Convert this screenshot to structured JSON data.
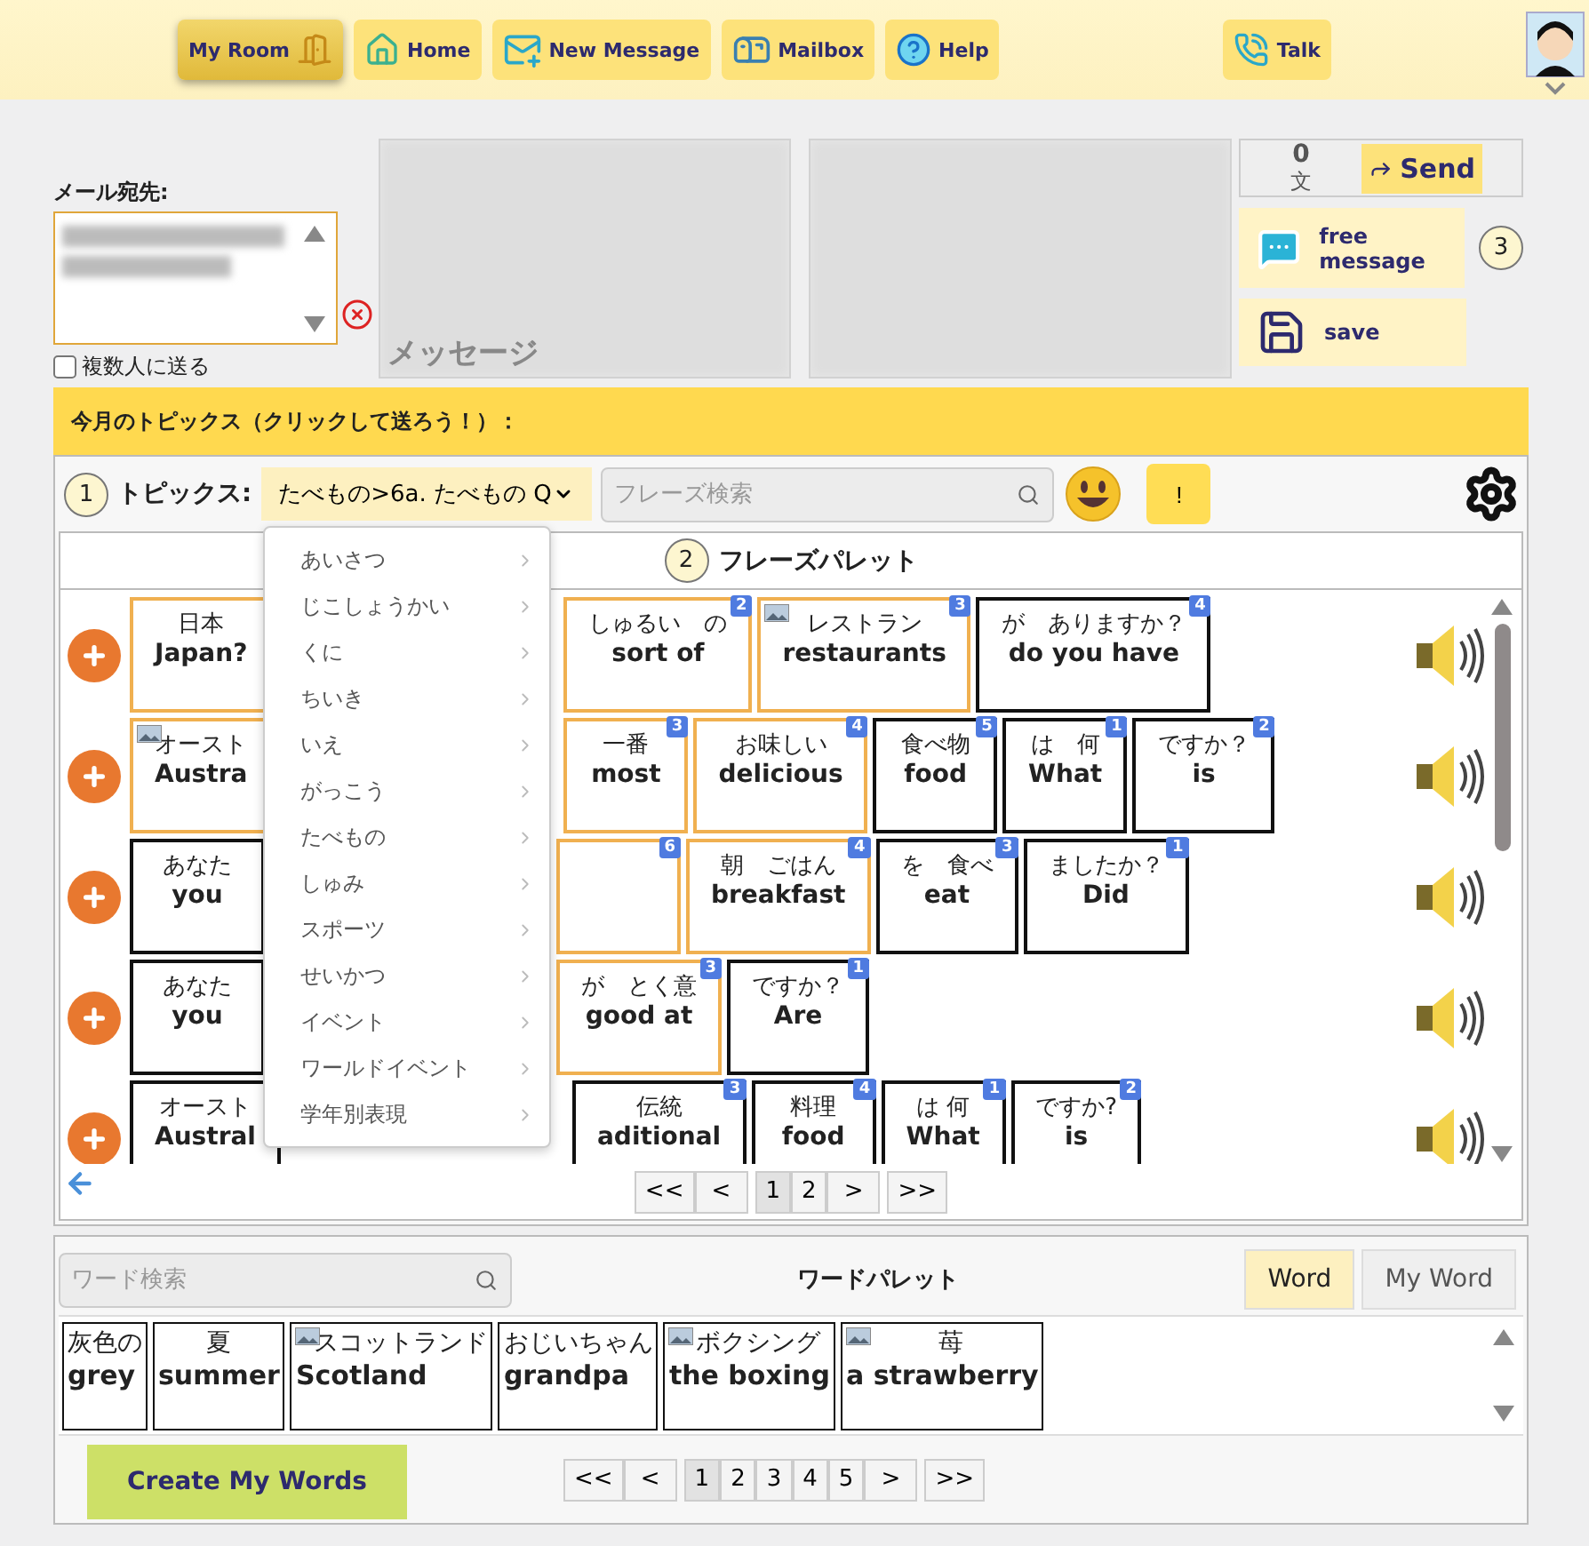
{
  "nav": [
    {
      "label": "My Room",
      "kind": "room",
      "selected": true
    },
    {
      "label": "Home",
      "kind": "home",
      "selected": false
    },
    {
      "label": "New Message",
      "kind": "new",
      "selected": false
    },
    {
      "label": "Mailbox",
      "kind": "mailbox",
      "selected": false
    },
    {
      "label": "Help",
      "kind": "help",
      "selected": false
    },
    {
      "label": "Talk",
      "kind": "talk",
      "selected": false
    }
  ],
  "compose": {
    "recipient_label": "メール宛先:",
    "multi_send": {
      "label": "複数人に送る",
      "checked": false
    },
    "message_placeholder": "メッセージ",
    "count": "0",
    "count_unit": "文",
    "send": "Send",
    "step": "3",
    "free_message": "free message",
    "save": "save"
  },
  "topics_banner": "今月のトピックス（クリックして送ろう！）：",
  "topics": {
    "step": "1",
    "label": "トピックス:",
    "selected": "たべもの>6a. たべもの Q",
    "search_placeholder": "フレーズ検索",
    "alert": "!"
  },
  "menu": [
    "あいさつ",
    "じこしょうかい",
    "くに",
    "ちいき",
    "いえ",
    "がっこう",
    "たべもの",
    "しゅみ",
    "スポーツ",
    "せいかつ",
    "イベント",
    "ワールドイベント",
    "学年別表現"
  ],
  "phrase_palette": {
    "step": "2",
    "title": "フレーズパレット",
    "rows": [
      {
        "first": {
          "jp": "日本",
          "en": "Japan?",
          "highlighted": true,
          "image": false
        },
        "cards": [
          {
            "jp": "しゅるい　の",
            "en": "sort of",
            "badge": "2",
            "highlighted": true,
            "image": false
          },
          {
            "jp": "レストラン",
            "en": "restaurants",
            "badge": "3",
            "highlighted": true,
            "image": true
          },
          {
            "jp": "が　ありますか？",
            "en": "do you have",
            "badge": "4",
            "highlighted": false,
            "image": false
          }
        ]
      },
      {
        "first": {
          "jp": "オースト",
          "en": "Austra",
          "highlighted": true,
          "image": true
        },
        "cards": [
          {
            "jp": "一番",
            "en": "most",
            "badge": "3",
            "highlighted": true,
            "image": false
          },
          {
            "jp": "お味しい",
            "en": "delicious",
            "badge": "4",
            "highlighted": true,
            "image": false
          },
          {
            "jp": "食べ物",
            "en": "food",
            "badge": "5",
            "highlighted": false,
            "image": false
          },
          {
            "jp": "は　何",
            "en": "What",
            "badge": "1",
            "highlighted": false,
            "image": false
          },
          {
            "jp": "ですか？",
            "en": "is",
            "badge": "2",
            "highlighted": false,
            "image": false
          }
        ]
      },
      {
        "first": {
          "jp": "あなた",
          "en": "you",
          "highlighted": false,
          "image": false
        },
        "cards": [
          {
            "badge": "6",
            "highlighted": true,
            "image": false
          },
          {
            "jp": "朝　ごはん",
            "en": "breakfast",
            "badge": "4",
            "highlighted": true,
            "image": false
          },
          {
            "jp": "を　食べ",
            "en": "eat",
            "badge": "3",
            "highlighted": false,
            "image": false
          },
          {
            "jp": "ましたか？",
            "en": "Did",
            "badge": "1",
            "highlighted": false,
            "image": false
          }
        ]
      },
      {
        "first": {
          "jp": "あなた",
          "en": "you",
          "highlighted": false,
          "image": false
        },
        "cards": [
          {
            "jp": "が　とく意",
            "en": "good at",
            "badge": "3",
            "highlighted": true,
            "image": false
          },
          {
            "jp": "ですか？",
            "en": "Are",
            "badge": "1",
            "highlighted": false,
            "image": false
          }
        ]
      },
      {
        "first": {
          "jp": "オースト",
          "en": "Austral",
          "highlighted": false,
          "image": false
        },
        "cards": [
          {
            "jp": "伝統",
            "en": "aditional",
            "badge": "3",
            "highlighted": false,
            "image": false
          },
          {
            "jp": "料理",
            "en": "food",
            "badge": "4",
            "highlighted": false,
            "image": false
          },
          {
            "jp": "は 何",
            "en": "What",
            "badge": "1",
            "highlighted": false,
            "image": false
          },
          {
            "jp": "ですか?",
            "en": "is",
            "badge": "2",
            "highlighted": false,
            "image": false
          }
        ]
      }
    ],
    "pages": [
      {
        "label": "<<",
        "selected": false
      },
      {
        "label": "<",
        "selected": false
      },
      {
        "label": "1",
        "selected": true
      },
      {
        "label": "2",
        "selected": false
      },
      {
        "label": ">",
        "selected": false
      },
      {
        "label": ">>",
        "selected": false
      }
    ]
  },
  "word_palette": {
    "search_placeholder": "ワード検索",
    "title": "ワードパレット",
    "tabs": [
      {
        "label": "Word",
        "selected": true
      },
      {
        "label": "My Word",
        "selected": false
      }
    ],
    "cards": [
      {
        "jp": "灰色の",
        "en": "grey",
        "image": false
      },
      {
        "jp": "夏",
        "en": "summer",
        "image": false
      },
      {
        "jp": "スコットランド",
        "en": "Scotland",
        "image": true
      },
      {
        "jp": "おじいちゃん",
        "en": "grandpa",
        "image": false
      },
      {
        "jp": "ボクシング",
        "en": "the boxing",
        "image": true
      },
      {
        "jp": "苺",
        "en": "a strawberry",
        "image": true
      }
    ],
    "create": "Create My Words",
    "pages": [
      {
        "label": "<<",
        "selected": false
      },
      {
        "label": "<",
        "selected": false
      },
      {
        "label": "1",
        "selected": true
      },
      {
        "label": "2",
        "selected": false
      },
      {
        "label": "3",
        "selected": false
      },
      {
        "label": "4",
        "selected": false
      },
      {
        "label": "5",
        "selected": false
      },
      {
        "label": ">",
        "selected": false
      },
      {
        "label": ">>",
        "selected": false
      }
    ]
  }
}
